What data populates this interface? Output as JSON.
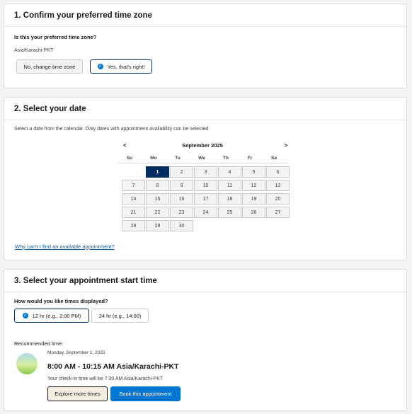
{
  "section1": {
    "title": "1. Confirm your preferred time zone",
    "question": "Is this your preferred time zone?",
    "timezone": "Asia/Karachi-PKT",
    "change_label": "No, change time zone",
    "confirm_label": "Yes, that's right!"
  },
  "section2": {
    "title": "2. Select your date",
    "instructions": "Select a date from the calendar. Only dates with appointment availability can be selected.",
    "calendar": {
      "month_label": "September 2025",
      "prev": "<",
      "next": ">",
      "weekdays": [
        "Su",
        "Mo",
        "Tu",
        "We",
        "Th",
        "Fr",
        "Sa"
      ],
      "selected_day": "1",
      "weeks": [
        [
          "",
          "1",
          "2",
          "3",
          "4",
          "5",
          "6"
        ],
        [
          "7",
          "8",
          "9",
          "10",
          "11",
          "12",
          "13"
        ],
        [
          "14",
          "15",
          "16",
          "17",
          "18",
          "19",
          "20"
        ],
        [
          "21",
          "22",
          "23",
          "24",
          "25",
          "26",
          "27"
        ],
        [
          "28",
          "29",
          "30",
          "",
          "",
          "",
          ""
        ]
      ]
    },
    "help_link": "Why can't I find an available appointment?"
  },
  "section3": {
    "title": "3. Select your appointment start time",
    "question": "How would you like times displayed?",
    "format_12": "12 hr (e.g., 2:00 PM)",
    "format_24": "24 hr (e.g., 14:00)",
    "recommended_label": "Recommended time:",
    "date": "Monday, September 1, 2025",
    "time_range": "8:00 AM - 10:15 AM Asia/Karachi-PKT",
    "checkin": "Your check-in time will be 7:30 AM Asia/Karachi-PKT",
    "explore_label": "Explore more times",
    "book_label": "Book this appointment"
  },
  "colors": {
    "brand": "#0176d3",
    "selected_navy": "#032d60",
    "link": "#0b5cab"
  }
}
